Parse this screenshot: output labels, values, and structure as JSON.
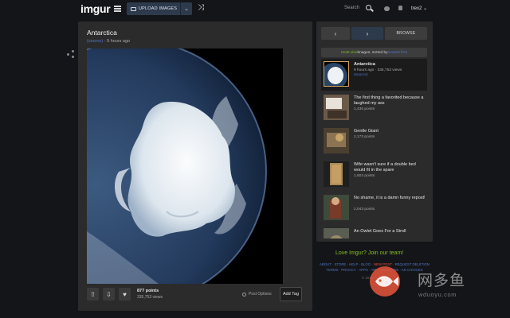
{
  "header": {
    "logo": "imgur",
    "upload_label": "UPLOAD IMAGES",
    "search_label": "Search",
    "username": "trex2"
  },
  "post": {
    "title": "Antarctica",
    "source_label": "(source)",
    "time_ago": " · 9 hours ago",
    "points": "877 points",
    "views": "335,753 views",
    "post_options": "Post Options",
    "add_tag": "Add Tag"
  },
  "sidebar": {
    "browse_label": "BROWSE",
    "sort": {
      "prefix": "most viral",
      "middle": " images, sorted by ",
      "sort_by": "newest first"
    },
    "items": [
      {
        "title": "Antarctica",
        "sub": "9 hours ago · 335,753 views",
        "extra": "(source)",
        "active": true
      },
      {
        "title": "The first thing a favorited because a laughed my ass",
        "sub": "1,436 points"
      },
      {
        "title": "Gentle Giant",
        "sub": "2,173 points"
      },
      {
        "title": "Wife wasn't sure if a double bed would fit in the spare",
        "sub": "1,602 points"
      },
      {
        "title": "No shame, it is a damn funny repost!",
        "sub": "2,043 points"
      },
      {
        "title": "An Owlet Goes For a Stroll",
        "sub": ""
      }
    ]
  },
  "footer": {
    "love": "Love Imgur? Join our team!",
    "links_row1": [
      "ABOUT",
      "STORE",
      "HELP",
      "BLOG",
      "NEW POST",
      "REQUEST DELETION"
    ],
    "links_row2": [
      "TERMS",
      "PRIVACY",
      "APPS",
      "API",
      "ADVERTISE",
      "AD CHOICES"
    ],
    "copyright": "© 2015"
  },
  "watermark": {
    "text": "网多鱼",
    "url": "wduoyu.com"
  },
  "colors": {
    "accent_green": "#85bf25",
    "link_blue": "#4e76c9",
    "nav_blue": "#2c3a4c",
    "panel": "#2b2b2b",
    "background": "#141518"
  }
}
